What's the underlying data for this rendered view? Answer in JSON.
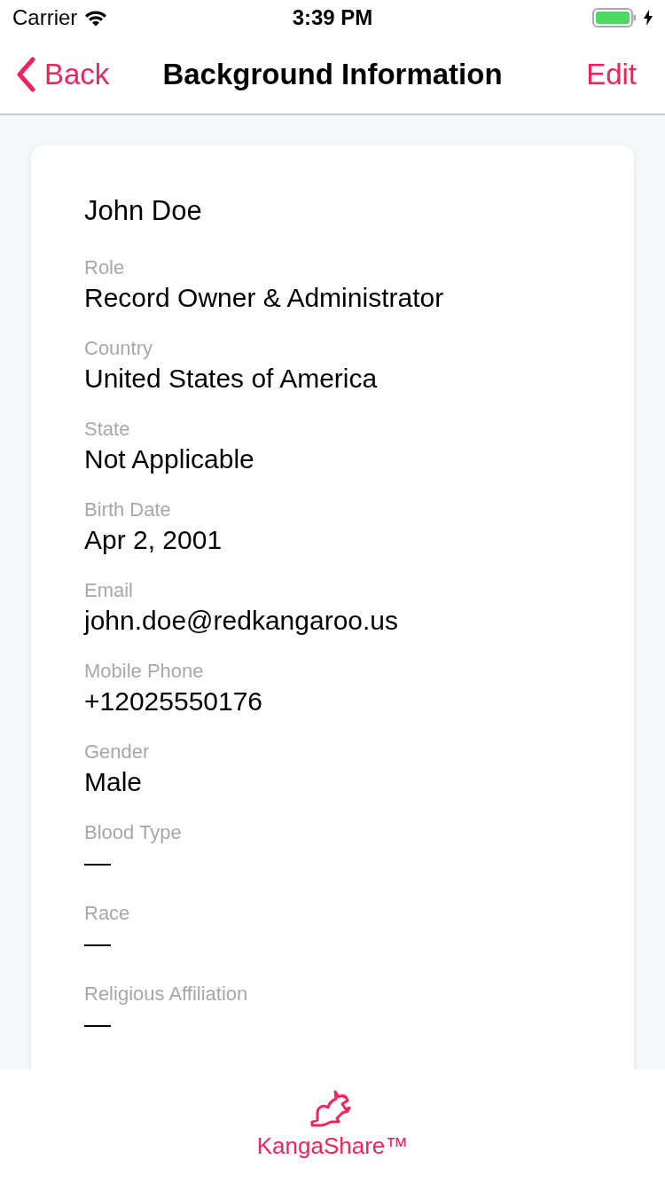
{
  "status_bar": {
    "carrier": "Carrier",
    "time": "3:39 PM",
    "charging": true
  },
  "nav": {
    "back": "Back",
    "title": "Background Information",
    "action": "Edit"
  },
  "profile": {
    "name": "John Doe",
    "fields": [
      {
        "label": "Role",
        "value": "Record Owner & Administrator"
      },
      {
        "label": "Country",
        "value": "United States of America"
      },
      {
        "label": "State",
        "value": "Not Applicable"
      },
      {
        "label": "Birth Date",
        "value": "Apr 2, 2001"
      },
      {
        "label": "Email",
        "value": "john.doe@redkangaroo.us"
      },
      {
        "label": "Mobile Phone",
        "value": "+12025550176"
      },
      {
        "label": "Gender",
        "value": "Male"
      },
      {
        "label": "Blood Type",
        "value": "—"
      },
      {
        "label": "Race",
        "value": "—"
      },
      {
        "label": "Religious Affiliation",
        "value": "—"
      }
    ]
  },
  "footer": {
    "brand": "KangaShare™"
  }
}
